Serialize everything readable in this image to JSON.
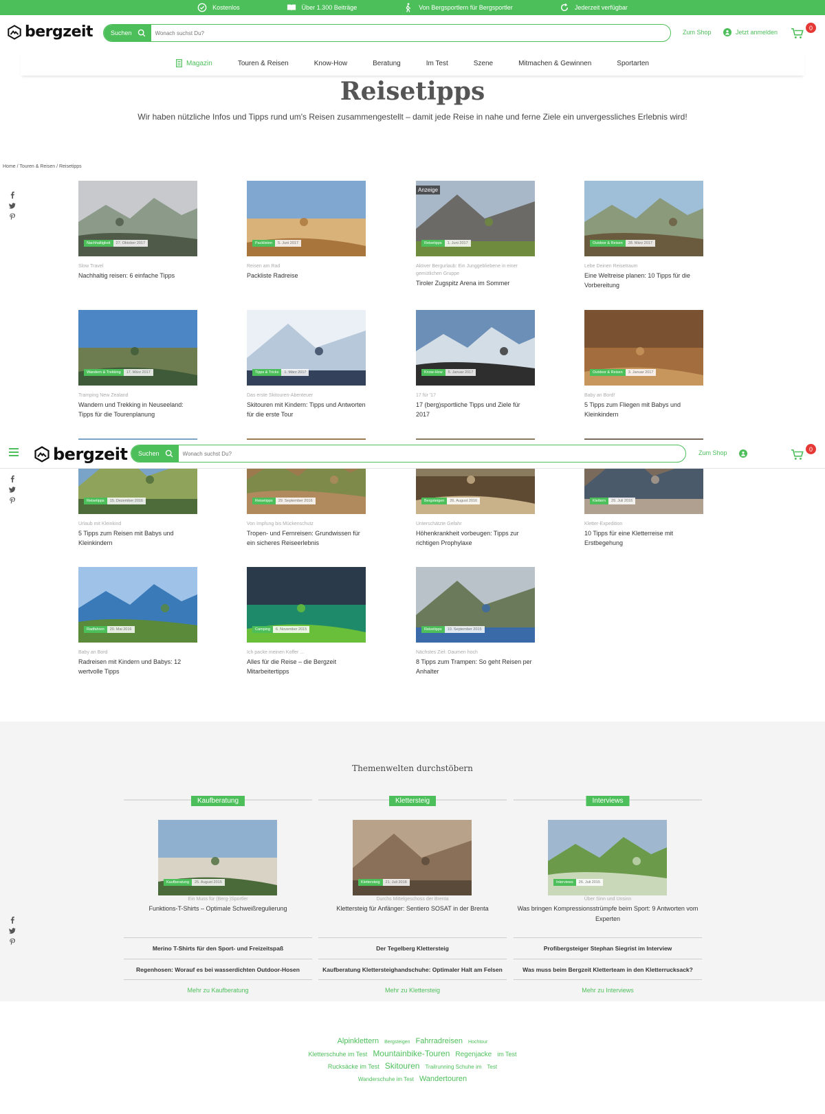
{
  "topbar": {
    "usps": [
      {
        "icon": "check-circle-icon",
        "label": "Kostenlos"
      },
      {
        "icon": "book-icon",
        "label": "Über 1.300 Beiträge"
      },
      {
        "icon": "hiker-icon",
        "label": "Von Bergsportlern für Bergsportler"
      },
      {
        "icon": "refresh-icon",
        "label": "Jederzeit verfügbar"
      }
    ]
  },
  "header": {
    "logo": "bergzeit",
    "search_label": "Suchen",
    "search_placeholder": "Wonach suchst Du?",
    "shop_link": "Zum Shop",
    "login_link": "Jetzt anmelden",
    "cart_count": "0"
  },
  "nav": {
    "items": [
      "Magazin",
      "Touren & Reisen",
      "Know-How",
      "Beratung",
      "Im Test",
      "Szene",
      "Mitmachen & Gewinnen",
      "Sportarten"
    ]
  },
  "page": {
    "title": "Reisetipps",
    "subtitle": "Wir haben nützliche Infos und Tipps rund um's Reisen zusammengestellt – damit jede Reise in nahe und ferne Ziele ein unvergessliches Erlebnis wird!",
    "breadcrumb": "Home / Touren & Reisen / Reisetipps"
  },
  "articles": [
    {
      "tag": "Nachhaltigkeit",
      "date": "27. Oktober 2017",
      "kicker": "Slow Travel",
      "title": "Nachhaltig reisen: 6 einfache Tipps"
    },
    {
      "tag": "Packlisten",
      "date": "5. Juni 2017",
      "kicker": "Reisen am Rad",
      "title": "Packliste Radreise"
    },
    {
      "tag": "Reisetipps",
      "date": "1. Juni 2017",
      "kicker": "Aktiver Bergurlaub: Ein Junggebliebene in einer gemütlichen Gruppe",
      "title": "Tiroler Zugspitz Arena im Sommer",
      "ad": "Anzeige"
    },
    {
      "tag": "Outdoor & Reisen",
      "date": "28. März 2017",
      "kicker": "Lebe Deinen Reisetraum",
      "title": "Eine Weltreise planen: 10 Tipps für die Vorbereitung"
    },
    {
      "tag": "Wandern & Trekking",
      "date": "17. März 2017",
      "kicker": "Tramping New Zealand",
      "title": "Wandern und Trekking in Neuseeland: Tipps für die Tourenplanung"
    },
    {
      "tag": "Tipps & Tricks",
      "date": "1. März 2017",
      "kicker": "Das erste Skitouren-Abenteuer",
      "title": "Skitouren mit Kindern: Tipps und Antworten für die erste Tour"
    },
    {
      "tag": "Know-How",
      "date": "5. Januar 2017",
      "kicker": "17 für '17",
      "title": "17 (berg)sportliche Tipps und Ziele für 2017"
    },
    {
      "tag": "Outdoor & Reisen",
      "date": "3. Januar 2017",
      "kicker": "Baby an Bord!",
      "title": "5 Tipps zum Fliegen mit Babys und Kleinkindern"
    },
    {
      "tag": "Reisetipps",
      "date": "15. Dezember 2016",
      "kicker": "Urlaub mit Kleinkind",
      "title": "5 Tipps zum Reisen mit Babys und Kleinkindern"
    },
    {
      "tag": "Reisetipps",
      "date": "29. September 2016",
      "kicker": "Von Impfung bis Mückenschutz",
      "title": "Tropen- und Fernreisen: Grundwissen für ein sicheres Reiseerlebnis"
    },
    {
      "tag": "Bergsteigen",
      "date": "26. August 2016",
      "kicker": "Unterschätzte Gefahr",
      "title": "Höhenkrankheit vorbeugen: Tipps zur richtigen Prophylaxe"
    },
    {
      "tag": "Klettern",
      "date": "29. Juli 2016",
      "kicker": "Kletter-Expedition",
      "title": "10 Tipps für eine Kletterreise mit Erstbegehung"
    },
    {
      "tag": "Radfahren",
      "date": "20. Mai 2016",
      "kicker": "Baby an Bord",
      "title": "Radreisen mit Kindern und Babys: 12 wertvolle Tipps"
    },
    {
      "tag": "Camping",
      "date": "6. November 2015",
      "kicker": "Ich packe meinen Koffer ...",
      "title": "Alles für die Reise – die Bergzeit Mitarbeitertipps"
    },
    {
      "tag": "Reisetipps",
      "date": "10. September 2015",
      "kicker": "Nächstes Ziel: Daumen hoch",
      "title": "8 Tipps zum Trampen: So geht Reisen per Anhalter"
    }
  ],
  "themen": {
    "heading": "Themenwelten durchstöbern",
    "columns": [
      {
        "label": "Kaufberatung",
        "tag": "Kaufberatung",
        "date": "25. August 2015",
        "kicker": "Ein Muss für (Berg-)Sportler",
        "title": "Funktions-T-Shirts – Optimale Schweißregulierung",
        "links": [
          "Merino T-Shirts für den Sport- und Freizeitspaß",
          "Regenhosen: Worauf es bei wasserdichten Outdoor-Hosen"
        ],
        "more": "Mehr zu Kaufberatung"
      },
      {
        "label": "Klettersteig",
        "tag": "Klettersteig",
        "date": "21. Juli 2018",
        "kicker": "Durchs Mittelgeschoss der Brenta",
        "title": "Klettersteig für Anfänger: Sentiero SOSAT in der Brenta",
        "links": [
          "Der Tegelberg Klettersteig",
          "Kaufberatung Klettersteighandschuhe: Optimaler Halt am Felsen"
        ],
        "more": "Mehr zu Klettersteig"
      },
      {
        "label": "Interviews",
        "tag": "Interviews",
        "date": "26. Juli 2015",
        "kicker": "Über Sinn und Unsinn",
        "title": "Was bringen Kompressionsstrümpfe beim Sport: 9 Antworten vom Experten",
        "links": [
          "Profibergsteiger Stephan Siegrist im Interview",
          "Was muss beim Bergzeit Kletterteam in den Kletterrucksack?"
        ],
        "more": "Mehr zu Interviews"
      }
    ]
  },
  "tagcloud": [
    {
      "label": "Alpinklettern",
      "size": 11
    },
    {
      "label": "Bergsteigen",
      "size": 7
    },
    {
      "label": "Fahrradreisen",
      "size": 11
    },
    {
      "label": "Hochtour",
      "size": 7
    },
    {
      "label": "Kletterschuhe im Test",
      "size": 9
    },
    {
      "label": "Mountainbike-Touren",
      "size": 12
    },
    {
      "label": "Regenjacke",
      "size": 10
    },
    {
      "label": "im Test",
      "size": 9
    },
    {
      "label": "Rucksäcke im Test",
      "size": 9
    },
    {
      "label": "Skitouren",
      "size": 12
    },
    {
      "label": "Trailrunning Schuhe im",
      "size": 8
    },
    {
      "label": "Test",
      "size": 8
    },
    {
      "label": "Wanderschuhe im Test",
      "size": 8
    },
    {
      "label": "Wandertouren",
      "size": 11
    }
  ],
  "colors": {
    "accent": "#4cbf5a",
    "badge": "#e53935"
  }
}
